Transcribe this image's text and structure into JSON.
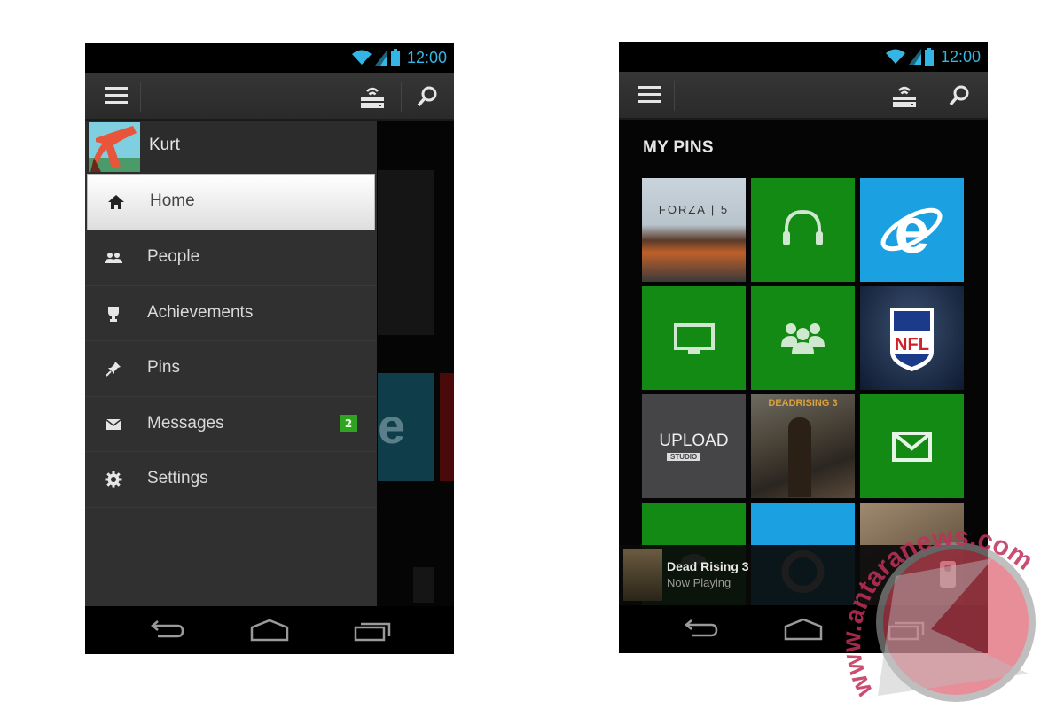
{
  "colors": {
    "status_blue": "#33b5e5",
    "xbox_green": "#138a13",
    "ie_blue": "#1ba1e2",
    "badge_green": "#2ea421",
    "drawer_bg": "#303030"
  },
  "left_screen": {
    "status_bar": {
      "time": "12:00",
      "icons": [
        "wifi-icon",
        "signal-icon",
        "battery-icon"
      ]
    },
    "action_bar": {
      "icons": [
        "menu-icon",
        "console-icon",
        "search-icon"
      ]
    },
    "profile": {
      "name": "Kurt",
      "avatar": "gamerpic-avatar"
    },
    "menu": [
      {
        "label": "Home",
        "icon": "home-icon",
        "active": true
      },
      {
        "label": "People",
        "icon": "people-icon"
      },
      {
        "label": "Achievements",
        "icon": "trophy-icon"
      },
      {
        "label": "Pins",
        "icon": "pin-icon"
      },
      {
        "label": "Messages",
        "icon": "mail-icon",
        "badge": "2"
      },
      {
        "label": "Settings",
        "icon": "gear-icon"
      }
    ],
    "nav_bar": [
      "back-icon",
      "home-nav-icon",
      "recents-icon"
    ]
  },
  "right_screen": {
    "status_bar": {
      "time": "12:00"
    },
    "section_title": "MY PINS",
    "tiles": [
      {
        "name": "Forza 5",
        "text": "FORZA | 5",
        "kind": "image"
      },
      {
        "name": "Music",
        "icon": "headphones-icon",
        "kind": "green"
      },
      {
        "name": "Internet Explorer",
        "icon": "ie-icon",
        "kind": "blue"
      },
      {
        "name": "TV",
        "icon": "tv-icon",
        "kind": "green"
      },
      {
        "name": "Friends",
        "icon": "friends-icon",
        "kind": "green"
      },
      {
        "name": "NFL",
        "text": "NFL",
        "kind": "image"
      },
      {
        "name": "Upload Studio",
        "text": "UPLOAD",
        "subtext": "STUDIO",
        "kind": "gray"
      },
      {
        "name": "Dead Rising 3",
        "text": "DEADRISING 3",
        "kind": "image"
      },
      {
        "name": "Messages",
        "icon": "mail-icon",
        "kind": "green"
      },
      {
        "name": "Xbox Games",
        "icon": "controller-icon",
        "kind": "green"
      },
      {
        "name": "Skype",
        "icon": "skype-icon",
        "kind": "blue"
      },
      {
        "name": "Game",
        "kind": "image"
      }
    ],
    "now_playing": {
      "title": "Dead Rising 3",
      "subtitle": "Now Playing"
    },
    "nav_bar": [
      "back-icon",
      "home-nav-icon",
      "recents-icon"
    ]
  },
  "watermark": {
    "text": "www.antaranews.com"
  }
}
